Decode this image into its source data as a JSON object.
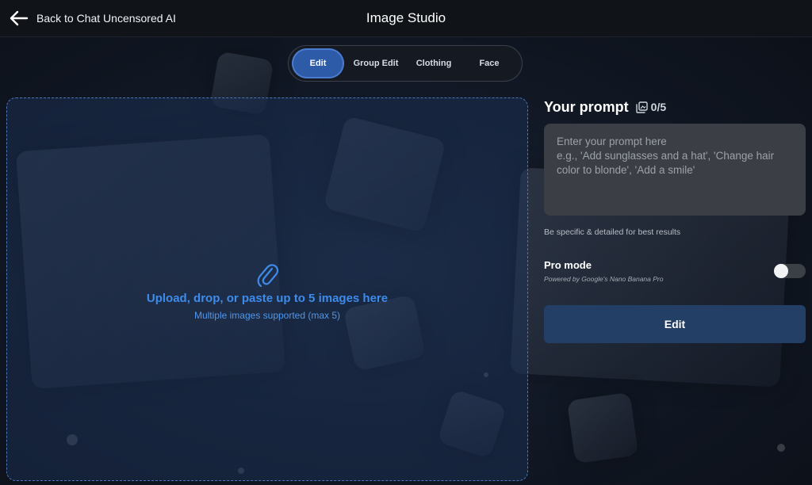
{
  "header": {
    "back_label": "Back to Chat Uncensored AI",
    "back_icon": "arrow-left-icon",
    "title": "Image Studio"
  },
  "tabs": [
    {
      "label": "Edit",
      "active": true
    },
    {
      "label": "Group Edit",
      "active": false
    },
    {
      "label": "Clothing",
      "active": false
    },
    {
      "label": "Face",
      "active": false
    }
  ],
  "upload": {
    "icon": "paperclip-icon",
    "title": "Upload, drop, or paste up to 5 images here",
    "subtitle": "Multiple images supported (max 5)"
  },
  "prompt": {
    "title": "Your prompt",
    "images_icon": "images-icon",
    "image_count": "0/5",
    "value": "",
    "placeholder": "Enter your prompt here\ne.g., 'Add sunglasses and a hat', 'Change hair color to blonde', 'Add a smile'",
    "hint": "Be specific & detailed for best results"
  },
  "pro_mode": {
    "title": "Pro mode",
    "subtitle": "Powered by Google's Nano Banana Pro",
    "enabled": false
  },
  "actions": {
    "edit_label": "Edit"
  },
  "colors": {
    "accent": "#2e5ba8",
    "upload_text": "#3d8bea",
    "edit_button": "#233f66"
  }
}
